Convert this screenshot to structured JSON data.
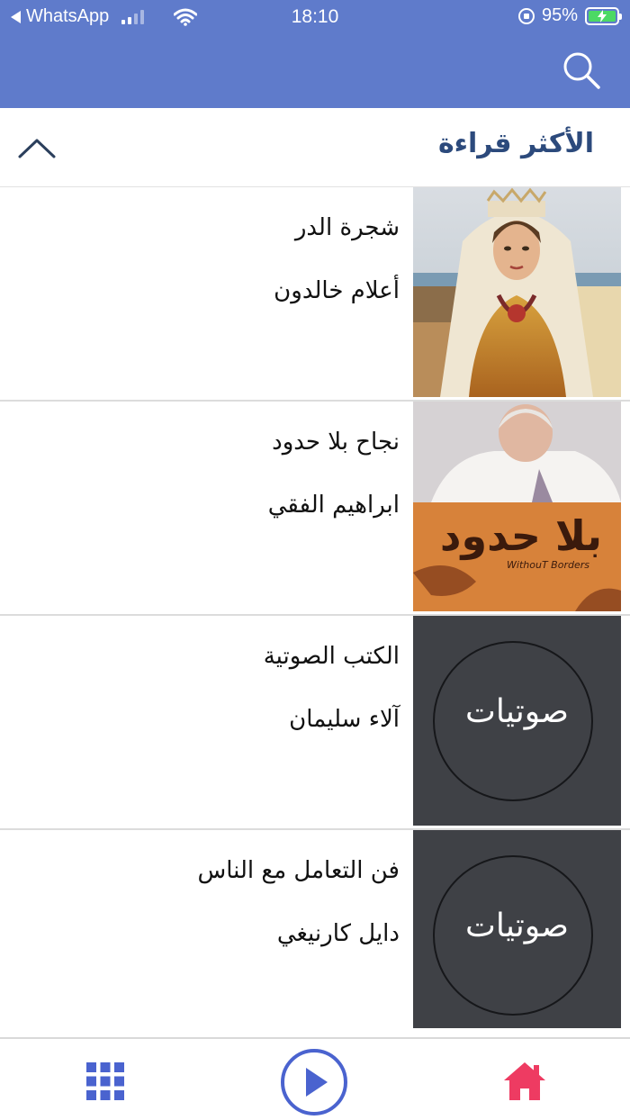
{
  "status_bar": {
    "back_app": "WhatsApp",
    "time": "18:10",
    "battery": "95%"
  },
  "header": {
    "search_icon": "search-icon"
  },
  "section": {
    "title": "الأكثر قراءة",
    "toggle_icon": "chevron-up-icon"
  },
  "books": [
    {
      "title": "شجرة الدر",
      "author": "أعلام خالدون",
      "cover": "painting-portrait"
    },
    {
      "title": "نجاح بلا حدود",
      "author": "ابراهيم الفقي",
      "cover": "book-cover-bila-hudood"
    },
    {
      "title": "الكتب الصوتية",
      "author": "آلاء سليمان",
      "cover_label": "صوتيات"
    },
    {
      "title": "فن التعامل مع الناس",
      "author": "دايل كارنيغي",
      "cover_label": "صوتيات"
    }
  ],
  "cover_art": {
    "bila_hudood": "بلا حدود",
    "without_borders": "WithouT Borders"
  },
  "tabbar": {
    "grid_icon": "grid-icon",
    "play_icon": "play-icon",
    "home_icon": "home-icon"
  },
  "colors": {
    "header_bg": "#5f7bcb",
    "section_title": "#2c4a7c",
    "tab_icon_blue": "#4a63cf",
    "home_pink": "#ee3b62",
    "audio_cover_bg": "#3f4146"
  }
}
